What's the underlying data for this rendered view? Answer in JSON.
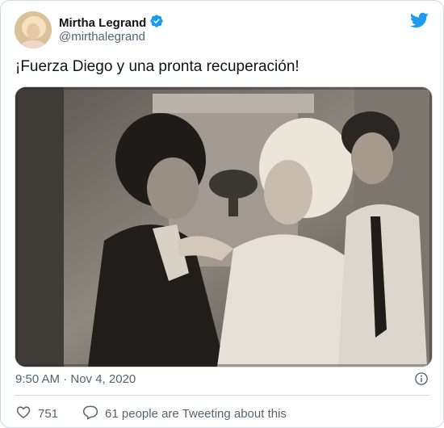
{
  "tweet": {
    "author_name": "Mirtha Legrand",
    "author_handle": "@mirthalegrand",
    "text": "¡Fuerza Diego y una pronta recuperación!",
    "timestamp": "9:50 AM · Nov 4, 2020",
    "likes": "751",
    "tweeting_about": "61 people are Tweeting about this"
  },
  "icons": {
    "verified": "verified-badge-icon",
    "brand": "twitter-bird-icon",
    "info": "info-icon",
    "like": "heart-icon",
    "reply": "speech-bubble-icon"
  },
  "colors": {
    "brand": "#1d9bf0",
    "text": "#0f1419",
    "secondary": "#536471",
    "border": "#cfd9de"
  }
}
